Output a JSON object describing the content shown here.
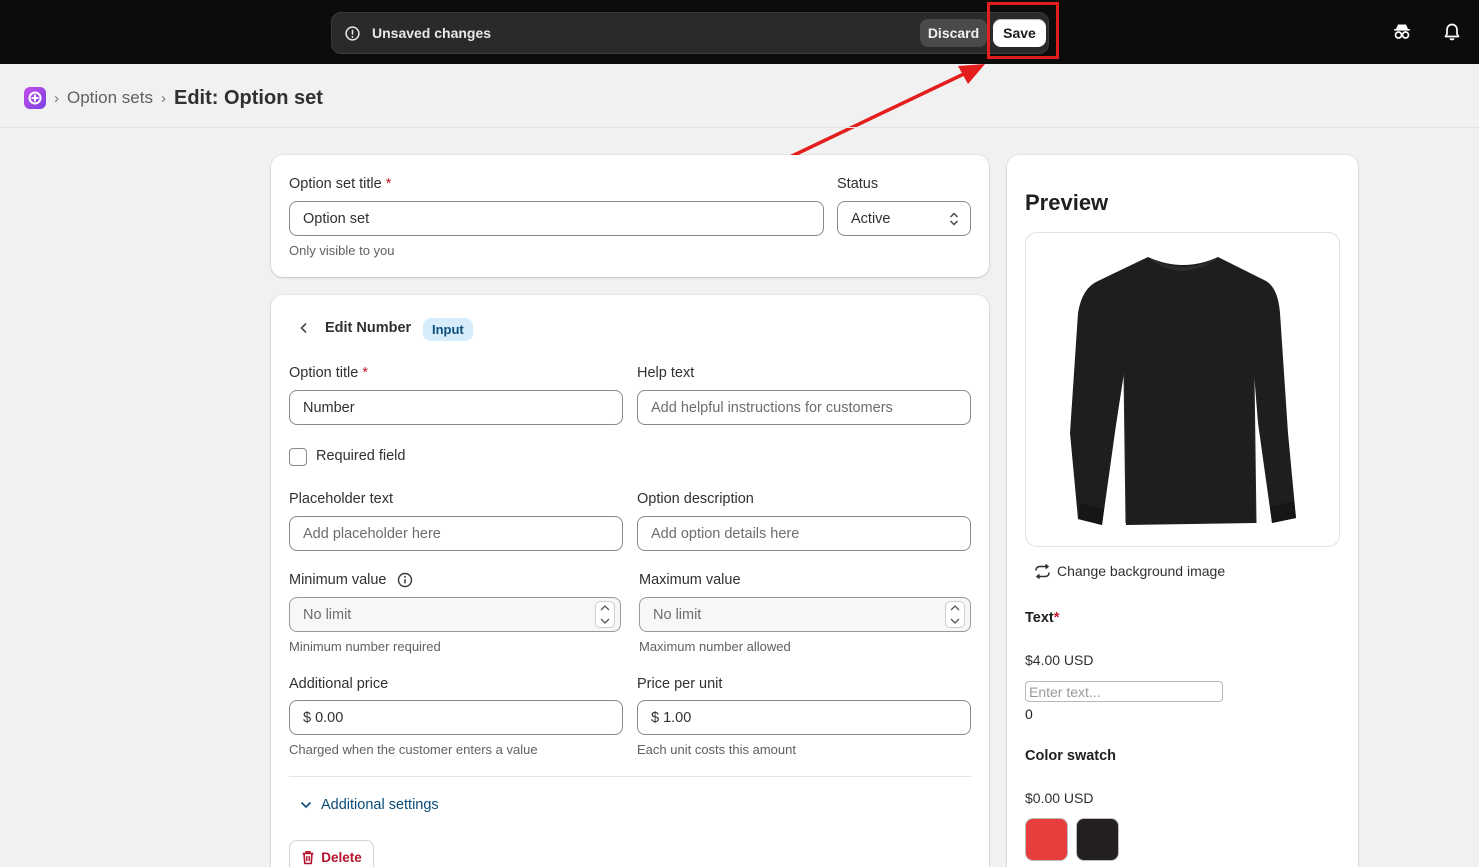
{
  "topbar": {
    "unsaved_text": "Unsaved changes",
    "discard_label": "Discard",
    "save_label": "Save",
    "icons": [
      "alert-circle-icon",
      "incognito-icon",
      "bell-icon"
    ]
  },
  "breadcrumb": {
    "parent": "Option sets",
    "separator": "›",
    "title": "Edit: Option set"
  },
  "option_set": {
    "title_label": "Option set title",
    "required_mark": "*",
    "title_value": "Option set",
    "title_hint": "Only visible to you",
    "status_label": "Status",
    "status_value": "Active"
  },
  "edit_option": {
    "heading": "Edit Number",
    "badge": "Input",
    "option_title_label": "Option title",
    "option_title_value": "Number",
    "help_text_label": "Help text",
    "help_text_placeholder": "Add helpful instructions for customers",
    "required_field_label": "Required field",
    "placeholder_label": "Placeholder text",
    "placeholder_placeholder": "Add placeholder here",
    "description_label": "Option description",
    "description_placeholder": "Add option details here",
    "min_label": "Minimum value",
    "min_placeholder": "No limit",
    "min_hint": "Minimum number required",
    "max_label": "Maximum value",
    "max_placeholder": "No limit",
    "max_hint": "Maximum number allowed",
    "add_price_label": "Additional price",
    "add_price_value": "$ 0.00",
    "add_price_hint": "Charged when the customer enters a value",
    "unit_price_label": "Price per unit",
    "unit_price_value": "$ 1.00",
    "unit_price_hint": "Each unit costs this amount",
    "additional_settings": "Additional settings",
    "delete_label": "Delete"
  },
  "preview": {
    "title": "Preview",
    "change_bg": "Change background image",
    "text_label": "Text",
    "text_price": "$4.00 USD",
    "text_placeholder": "Enter text...",
    "text_count": "0",
    "swatch_label": "Color swatch",
    "swatch_price": "$0.00 USD",
    "swatch_colors": [
      "#e83d3d",
      "#231f20"
    ]
  }
}
